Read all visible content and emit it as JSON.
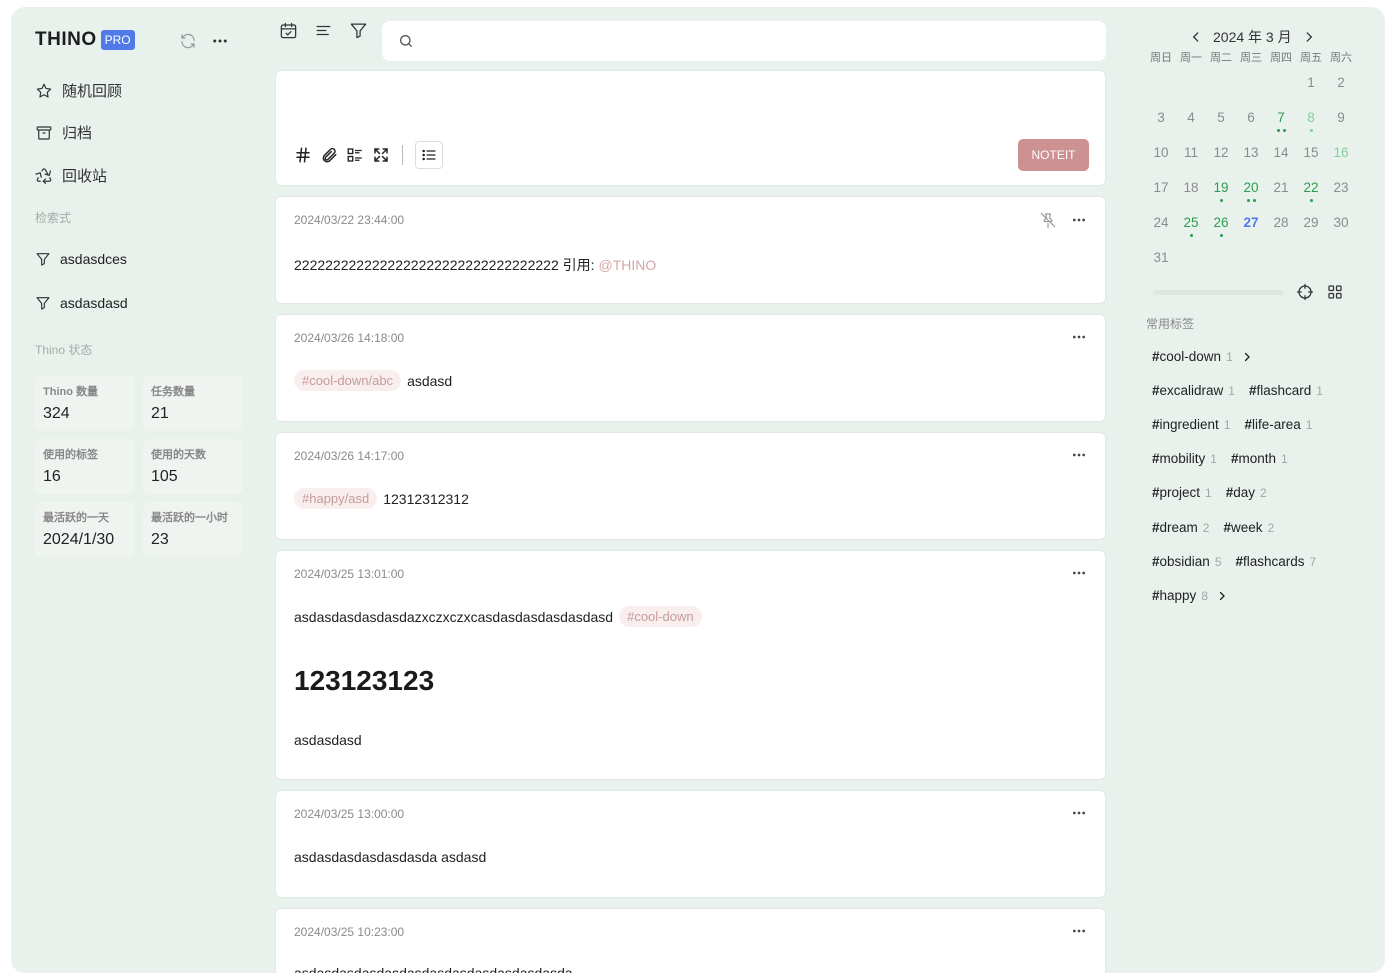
{
  "brand": {
    "name": "THINO",
    "badge": "PRO"
  },
  "nav": [
    {
      "label": "随机回顾",
      "icon": "star-icon"
    },
    {
      "label": "归档",
      "icon": "archive-icon"
    },
    {
      "label": "回收站",
      "icon": "recycle-icon"
    }
  ],
  "filters_label": "检索式",
  "filters": [
    "asdasdces",
    "asdasdasd"
  ],
  "stats_label": "Thino 状态",
  "stats": [
    {
      "label": "Thino 数量",
      "value": "324"
    },
    {
      "label": "任务数量",
      "value": "21"
    },
    {
      "label": "使用的标签",
      "value": "16"
    },
    {
      "label": "使用的天数",
      "value": "105"
    },
    {
      "label": "最活跃的一天",
      "value": "2024/1/30"
    },
    {
      "label": "最活跃的一小时",
      "value": "23"
    }
  ],
  "search": {
    "placeholder": ""
  },
  "editor": {
    "submit_label": "NOTEIT"
  },
  "memos": [
    {
      "time": "2024/03/22 23:44:00",
      "text": "2222222222222222222222222222222222 引用:",
      "ref": "@THINO"
    },
    {
      "time": "2024/03/26 14:18:00",
      "tag": "#cool-down/abc",
      "text": "asdasd"
    },
    {
      "time": "2024/03/26 14:17:00",
      "tag": "#happy/asd",
      "text": "12312312312"
    },
    {
      "time": "2024/03/25 13:01:00",
      "text": "asdasdasdasdasdazxczxczxcasdasdasdasdasdasd",
      "tag": "#cool-down",
      "heading": "123123123",
      "text2": "asdasdasd"
    },
    {
      "time": "2024/03/25 13:00:00",
      "text": "asdasdasdasdasdasda asdasd"
    },
    {
      "time": "2024/03/25 10:23:00",
      "text": "asdasdasdasdasdasdasdasdasdasdasdasda"
    }
  ],
  "calendar": {
    "title": "2024 年 3 月",
    "weekdays": [
      "周日",
      "周一",
      "周二",
      "周三",
      "周四",
      "周五",
      "周六"
    ],
    "weeks": [
      [
        "",
        "",
        "",
        "",
        "",
        "1",
        "2"
      ],
      [
        "3",
        "4",
        "5",
        "6",
        "7",
        "8",
        "9"
      ],
      [
        "10",
        "11",
        "12",
        "13",
        "14",
        "15",
        "16"
      ],
      [
        "17",
        "18",
        "19",
        "20",
        "21",
        "22",
        "23"
      ],
      [
        "24",
        "25",
        "26",
        "27",
        "28",
        "29",
        "30"
      ],
      [
        "31",
        "",
        "",
        "",
        "",
        "",
        ""
      ]
    ],
    "today": "27",
    "accent_today": "#4f7ae8",
    "accent_active": "#2c9d4f"
  },
  "tags_label": "常用标签",
  "tag_rows": [
    [
      {
        "name": "cool-down",
        "count": "1",
        "expand": true
      }
    ],
    [
      {
        "name": "excalidraw",
        "count": "1"
      },
      {
        "name": "flashcard",
        "count": "1"
      }
    ],
    [
      {
        "name": "ingredient",
        "count": "1"
      },
      {
        "name": "life-area",
        "count": "1"
      }
    ],
    [
      {
        "name": "mobility",
        "count": "1"
      },
      {
        "name": "month",
        "count": "1"
      }
    ],
    [
      {
        "name": "project",
        "count": "1"
      },
      {
        "name": "day",
        "count": "2"
      }
    ],
    [
      {
        "name": "dream",
        "count": "2"
      },
      {
        "name": "week",
        "count": "2"
      }
    ],
    [
      {
        "name": "obsidian",
        "count": "5"
      },
      {
        "name": "flashcards",
        "count": "7"
      }
    ],
    [
      {
        "name": "happy",
        "count": "8",
        "expand": true
      }
    ]
  ]
}
